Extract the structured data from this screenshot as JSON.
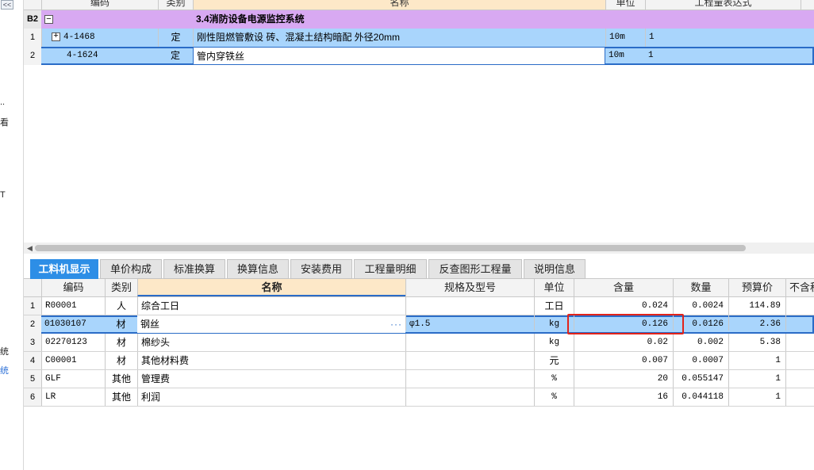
{
  "left_strip": {
    "collapse_label": "<<",
    "chars": [
      {
        "text": "..",
        "blue": false
      },
      {
        "text": "看",
        "blue": false
      },
      {
        "text": "T",
        "blue": false
      },
      {
        "text": "统",
        "blue": false
      },
      {
        "text": "统",
        "blue": true
      }
    ]
  },
  "top_grid": {
    "headers": {
      "code": "编码",
      "category": "类别",
      "name": "名称",
      "unit": "单位",
      "expr": "工程量表达式"
    },
    "section": {
      "no": "B2",
      "toggle": "−",
      "name": "3.4消防设备电源监控系统"
    },
    "rows": [
      {
        "no": "1",
        "toggle": "+",
        "code": "4-1468",
        "category": "定",
        "name": "刚性阻燃管敷设 砖、混凝土结构暗配 外径20mm",
        "unit": "10m",
        "qty": "1"
      },
      {
        "no": "2",
        "code": "4-1624",
        "category": "定",
        "name": "管内穿铁丝",
        "unit": "10m",
        "qty": "1"
      }
    ]
  },
  "scrollbar": {
    "left_arrow": "◀"
  },
  "tabs": [
    {
      "label": "工料机显示",
      "active": true
    },
    {
      "label": "单价构成",
      "active": false
    },
    {
      "label": "标准换算",
      "active": false
    },
    {
      "label": "换算信息",
      "active": false
    },
    {
      "label": "安装费用",
      "active": false
    },
    {
      "label": "工程量明细",
      "active": false
    },
    {
      "label": "反查图形工程量",
      "active": false
    },
    {
      "label": "说明信息",
      "active": false
    }
  ],
  "bottom_grid": {
    "headers": {
      "code": "编码",
      "category": "类别",
      "name": "名称",
      "spec": "规格及型号",
      "unit": "单位",
      "content": "含量",
      "qty": "数量",
      "price": "预算价",
      "extra": "不含税"
    },
    "rows": [
      {
        "no": "1",
        "code": "R00001",
        "category": "人",
        "name": "综合工日",
        "spec": "",
        "unit": "工日",
        "content": "0.024",
        "qty": "0.0024",
        "price": "114.89"
      },
      {
        "no": "2",
        "code": "01030107",
        "category": "材",
        "name": "钢丝",
        "spec": "φ1.5",
        "unit": "kg",
        "content": "0.126",
        "qty": "0.0126",
        "price": "2.36",
        "selected": true
      },
      {
        "no": "3",
        "code": "02270123",
        "category": "材",
        "name": "棉纱头",
        "spec": "",
        "unit": "kg",
        "content": "0.02",
        "qty": "0.002",
        "price": "5.38"
      },
      {
        "no": "4",
        "code": "C00001",
        "category": "材",
        "name": "其他材料费",
        "spec": "",
        "unit": "元",
        "content": "0.007",
        "qty": "0.0007",
        "price": "1"
      },
      {
        "no": "5",
        "code": "GLF",
        "category": "其他",
        "name": "管理费",
        "spec": "",
        "unit": "%",
        "content": "20",
        "qty": "0.055147",
        "price": "1"
      },
      {
        "no": "6",
        "code": "LR",
        "category": "其他",
        "name": "利润",
        "spec": "",
        "unit": "%",
        "content": "16",
        "qty": "0.044118",
        "price": "1"
      }
    ],
    "more_button": "···"
  },
  "colors": {
    "section_row": "#d8a9f2",
    "selected_row": "#a9d5fc",
    "active_tab": "#2d8ee6",
    "highlight_box": "#e2231a"
  }
}
